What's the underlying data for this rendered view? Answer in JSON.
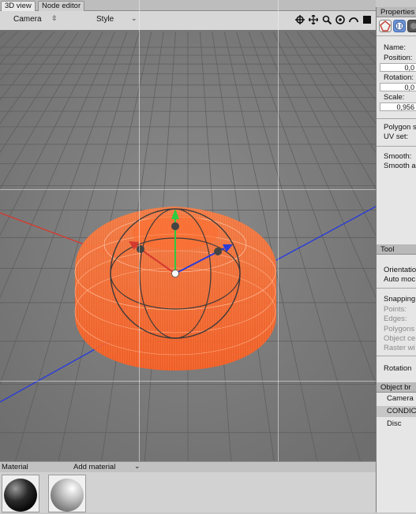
{
  "tabs": [
    {
      "label": "3D view",
      "active": true
    },
    {
      "label": "Node editor",
      "active": false
    }
  ],
  "viewport_toolbar": {
    "camera_label": "Camera",
    "style_label": "Style",
    "tool_icons": [
      "move-icon",
      "pan-icon",
      "zoom-icon",
      "orbit-icon",
      "rotate-view-icon",
      "fullscreen-icon"
    ]
  },
  "properties": {
    "header": "Properties",
    "tab_icons": [
      "object-icon",
      "material-icon",
      "tag-icon"
    ],
    "name_label": "Name:",
    "position_label": "Position:",
    "position_value": "0,0",
    "rotation_label": "Rotation:",
    "rotation_value": "0,0",
    "scale_label": "Scale:",
    "scale_value": "0,956",
    "polygon_label": "Polygon s",
    "uvset_label": "UV set:",
    "smooth_label": "Smooth:",
    "smooth_angle_label": "Smooth a"
  },
  "tool": {
    "header": "Tool",
    "orientation_label": "Orientatio",
    "auto_mode_label": "Auto moc",
    "snapping_label": "Snapping",
    "points_label": "Points:",
    "edges_label": "Edges:",
    "polygons_label": "Polygons",
    "object_center_label": "Object ce",
    "raster_label": "Raster wi",
    "rotation_label": "Rotation"
  },
  "object_browser": {
    "header": "Object br",
    "items": [
      {
        "label": "Camera",
        "selected": false
      },
      {
        "label": "CONDIC",
        "selected": true
      },
      {
        "label": "Disc",
        "selected": false
      }
    ]
  },
  "material_bar": {
    "material_label": "Material",
    "add_material_label": "Add material"
  },
  "colors": {
    "mesh": "#ff6a2a",
    "grid_bg": "#808080",
    "axis_red": "#d43a2e",
    "axis_blue": "#2a3cd8",
    "gizmo_green": "#2ecc40",
    "selection_accent": "#7a9fd6"
  }
}
